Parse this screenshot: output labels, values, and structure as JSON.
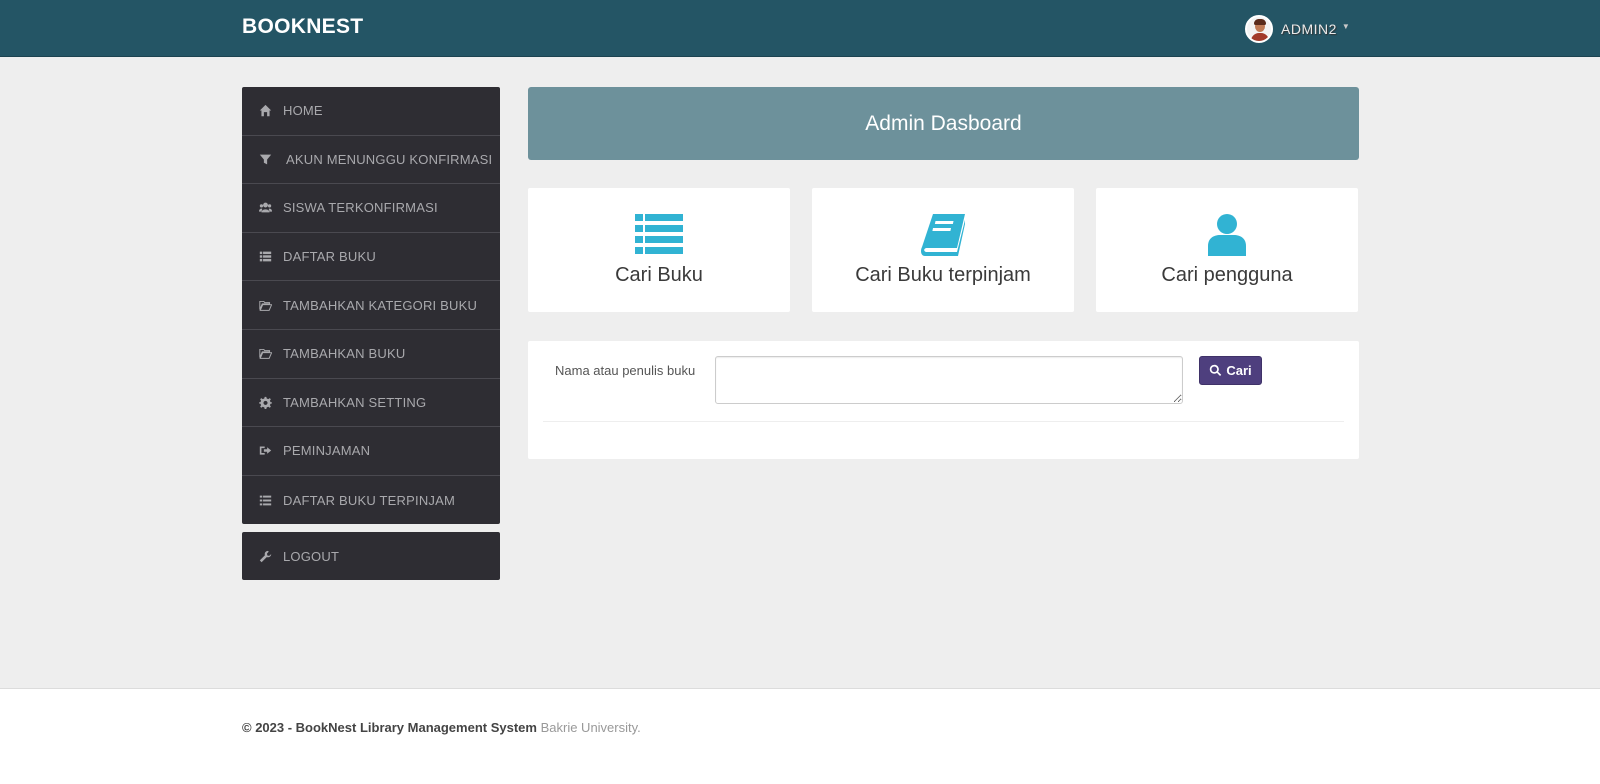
{
  "navbar": {
    "brand": "BOOKNEST",
    "username": "ADMIN2"
  },
  "sidebar": {
    "items": [
      {
        "label": "HOME",
        "icon": "home-icon"
      },
      {
        "label": "AKUN MENUNGGU KONFIRMASI",
        "icon": "filter-icon"
      },
      {
        "label": "SISWA TERKONFIRMASI",
        "icon": "users-icon"
      },
      {
        "label": "DAFTAR BUKU",
        "icon": "list-icon"
      },
      {
        "label": "TAMBAHKAN KATEGORI BUKU",
        "icon": "folder-open-icon"
      },
      {
        "label": "TAMBAHKAN BUKU",
        "icon": "folder-open-icon"
      },
      {
        "label": "TAMBAHKAN SETTING",
        "icon": "gear-icon"
      },
      {
        "label": "PEMINJAMAN",
        "icon": "sign-out-icon"
      },
      {
        "label": "DAFTAR BUKU TERPINJAM",
        "icon": "list-icon"
      }
    ],
    "logout": {
      "label": "LOGOUT",
      "icon": "wrench-icon"
    }
  },
  "main": {
    "title": "Admin Dasboard",
    "cards": [
      {
        "label": "Cari Buku",
        "icon": "list-icon"
      },
      {
        "label": "Cari Buku terpinjam",
        "icon": "book-icon"
      },
      {
        "label": "Cari pengguna",
        "icon": "user-icon"
      }
    ],
    "search": {
      "label": "Nama atau penulis buku",
      "value": "",
      "placeholder": "",
      "button_label": "Cari",
      "button_icon": "search-icon"
    }
  },
  "footer": {
    "copyright": "© 2023 - BookNest Library Management System",
    "org": "Bakrie University."
  },
  "colors": {
    "navbar": "#245565",
    "sidebar": "#2e2d33",
    "header_panel": "#6d919b",
    "card_icon": "#31b3d3",
    "search_button": "#4e3f7e"
  }
}
